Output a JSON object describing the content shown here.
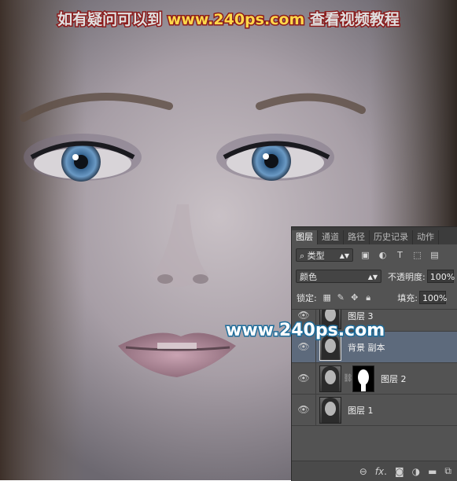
{
  "banner": {
    "part1": "如有疑问可以到",
    "part2": "www.240ps.com",
    "part3": "查看视频教程"
  },
  "watermark": "www.240ps.com",
  "layers_panel": {
    "tabs": [
      "图层",
      "通道",
      "路径",
      "历史记录",
      "动作"
    ],
    "active_tab": "图层",
    "filter_kind": "类型",
    "blend_mode": "颜色",
    "opacity_label": "不透明度:",
    "opacity_value": "100%",
    "lock_label": "锁定:",
    "fill_label": "填充:",
    "fill_value": "100%",
    "layers": [
      {
        "name": "图层 3",
        "selected": false,
        "has_mask": false
      },
      {
        "name": "背景 副本",
        "selected": true,
        "has_mask": false
      },
      {
        "name": "图层 2",
        "selected": false,
        "has_mask": true
      },
      {
        "name": "图层 1",
        "selected": false,
        "has_mask": false
      }
    ]
  },
  "colors": {
    "panel_bg": "#535353",
    "selected_layer": "#5d6a7c",
    "banner_stroke": "#8b1c1c",
    "banner_url": "#ffd84a",
    "watermark_stroke": "#1d6c9a"
  }
}
